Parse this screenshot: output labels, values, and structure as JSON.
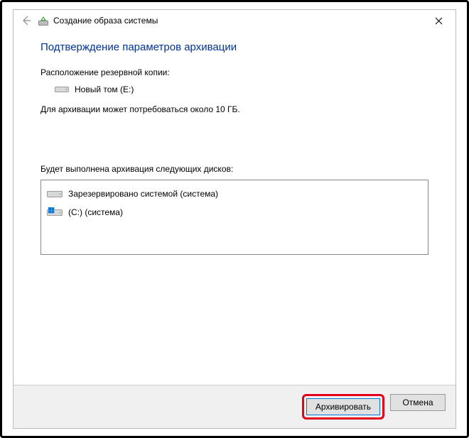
{
  "window": {
    "title": "Создание образа системы"
  },
  "content": {
    "heading": "Подтверждение параметров архивации",
    "location_label": "Расположение резервной копии:",
    "target_drive": "Новый том (E:)",
    "size_note": "Для архивации может потребоваться около 10 ГБ.",
    "drives_label": "Будет выполнена архивация следующих дисков:",
    "drives": [
      {
        "label": "Зарезервировано системой (система)",
        "os": false
      },
      {
        "label": "(C:) (система)",
        "os": true
      }
    ]
  },
  "footer": {
    "primary": "Архивировать",
    "cancel": "Отмена"
  }
}
